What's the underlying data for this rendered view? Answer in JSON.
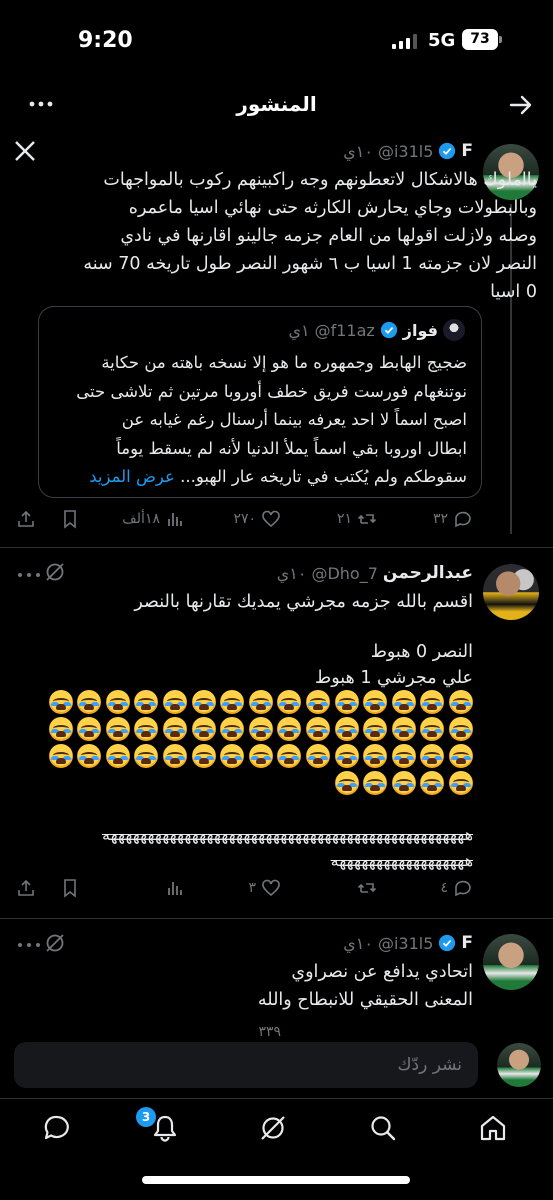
{
  "status_bar": {
    "time": "9:20",
    "network": "5G",
    "battery": "73"
  },
  "header": {
    "title": "المنشور",
    "back_icon": "arrow-right-icon",
    "more_icon": "more-horizontal-icon"
  },
  "tweets": [
    {
      "name": "F",
      "handle": "@i31l5",
      "time": "١٠ي",
      "text": "يااملوك هالاشكال لاتعطونهم وجه راكبينهم ركوب بالمواجهات\nوبالبطولات وجاي يحارش الكارثه حتى نهائي اسيا ماعمره\nوصله ولازلت اقولها من العام جزمه جالينو اقارنها في نادي\nالنصر لان جزمته 1 اسيا ب ٦ شهور النصر طول تاريخه 70 سنه\n0 اسيا",
      "quote": {
        "name": "فواز",
        "handle": "@f11az",
        "time": "١ي",
        "text": "ضجيج الهابط وجمهوره ما هو إلا نسخه باهته من حكاية\nنوتنغهام فورست فريق خطف أوروبا مرتين ثم تلاشى حتى\nاصبح اسماً لا احد يعرفه بينما أرسنال رغم غيابه عن\nابطال اوروبا بقي اسماً يملأ الدنيا لأنه لم يسقط يوماً\nسقوطكم ولم يُكتب في تاريخه عار الهبو...",
        "show_more": "عرض المزيد"
      },
      "actions": {
        "replies": "٣٢",
        "retweets": "٢١",
        "likes": "٢٧٠",
        "views": "١٨ألف"
      }
    },
    {
      "name": "عبدالرحمن",
      "handle": "@Dho_7",
      "time": "١٠ي",
      "line1": "اقسم بالله جزمه مجرشي يمديك تقارنها بالنصر",
      "line2": "النصر 0 هبوط",
      "line3": "علي مجرشي 1 هبوط",
      "emoji_count": 50,
      "strike1": "هههههههههههههههههههههههههههههههههههههههههههههههههه",
      "strike2": "ههههههههههههههههههه",
      "actions": {
        "replies": "٤",
        "retweets": "",
        "likes": "٣",
        "views": ""
      }
    },
    {
      "name": "F",
      "handle": "@i31l5",
      "time": "١٠ي",
      "text": "اتحادي يدافع عن نصراوي\nالمعنى الحقيقي للانبطاح والله",
      "actions": {
        "likes": "٣٣٩"
      }
    }
  ],
  "reply_bar": {
    "placeholder": "نشر ردّك"
  },
  "bottom_nav": {
    "notifications_badge": "3"
  },
  "colors": {
    "accent": "#1d9bf0",
    "muted": "#71767b",
    "background": "#000000"
  }
}
